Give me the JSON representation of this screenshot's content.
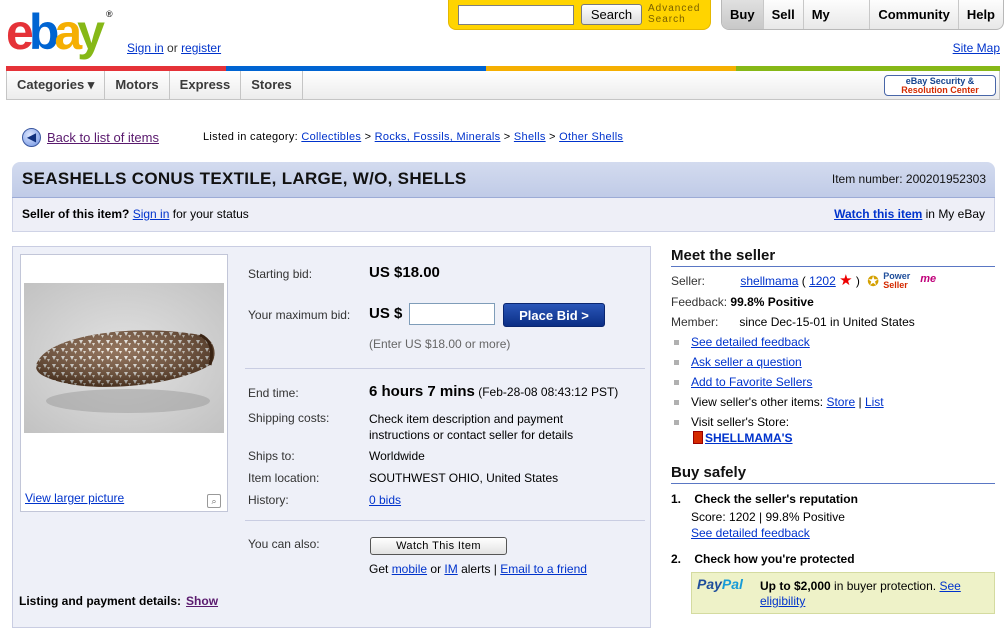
{
  "header": {
    "logo_letters": [
      "e",
      "b",
      "a",
      "y"
    ],
    "logo_colors": [
      "#e53238",
      "#0064d2",
      "#f5af02",
      "#86b817"
    ],
    "sign_in": "Sign in",
    "or": "or",
    "register": "register",
    "search_placeholder": "",
    "search_button": "Search",
    "advanced_line1": "Advanced",
    "advanced_line2": "Search",
    "nav": [
      "Buy",
      "Sell",
      "My eBay",
      "Community",
      "Help"
    ],
    "site_map": "Site Map"
  },
  "categories_nav": {
    "items": [
      "Categories ▾",
      "Motors",
      "Express",
      "Stores"
    ],
    "security_line1": "eBay Security &",
    "security_line2": "Resolution Center"
  },
  "breadcrumb": {
    "back_label": "Back to list of items",
    "listed_in": "Listed in category:",
    "crumbs": [
      "Collectibles",
      "Rocks, Fossils, Minerals",
      "Shells",
      "Other Shells"
    ],
    "sep": ">"
  },
  "item": {
    "title": "SEASHELLS CONUS TEXTILE, LARGE, W/O, SHELLS",
    "item_number": "Item number: 200201952303",
    "seller_question": "Seller of this item?",
    "sign_in": "Sign in",
    "for_status": "for your status",
    "watch_link": "Watch this item",
    "in_my_ebay": "in My eBay"
  },
  "bid": {
    "view_larger": "View larger picture",
    "starting_label": "Starting bid:",
    "starting_value": "US $18.00",
    "max_label": "Your maximum bid:",
    "currency": "US $",
    "place_bid": "Place Bid >",
    "enter_hint": "(Enter US $18.00 or more)",
    "end_label": "End time:",
    "end_bold": "6 hours 7 mins",
    "end_detail": "(Feb-28-08 08:43:12 PST)",
    "ship_label": "Shipping costs:",
    "ship_line1": "Check item description and payment",
    "ship_line2": "instructions or contact seller for details",
    "ships_to_label": "Ships to:",
    "ships_to": "Worldwide",
    "location_label": "Item location:",
    "location": "SOUTHWEST OHIO, United States",
    "history_label": "History:",
    "history": "0 bids",
    "also_label": "You can also:",
    "watch_button": "Watch This Item",
    "get": "Get",
    "mobile": "mobile",
    "or": "or",
    "im": "IM",
    "alerts": "alerts |",
    "email": "Email to a friend",
    "listing_label": "Listing and payment details:",
    "show": "Show"
  },
  "seller": {
    "heading": "Meet the seller",
    "seller_label": "Seller:",
    "name": "shellmama",
    "score_open": "(",
    "score": "1202",
    "score_close": ")",
    "power_line1": "Power",
    "power_line2": "Seller",
    "me": "me",
    "feedback_label": "Feedback:",
    "feedback": "99.8% Positive",
    "member_label": "Member:",
    "member": "since Dec-15-01 in United States",
    "links": [
      "See detailed feedback",
      "Ask seller a question",
      "Add to Favorite Sellers"
    ],
    "other_items": "View seller's other items:",
    "store": "Store",
    "pipe": "|",
    "list": "List",
    "visit_store": "Visit seller's Store:",
    "store_name": "SHELLMAMA'S"
  },
  "buy_safely": {
    "heading": "Buy safely",
    "step1_num": "1.",
    "step1": "Check the seller's reputation",
    "score_line": "Score: 1202 | 99.8% Positive",
    "see_feedback": "See detailed feedback",
    "step2_num": "2.",
    "step2": "Check how you're protected",
    "paypal_pay": "Pay",
    "paypal_pal": "Pal",
    "protect_bold": "Up to $2,000",
    "protect_text": "in buyer protection.",
    "see_eligibility": "See eligibility"
  }
}
